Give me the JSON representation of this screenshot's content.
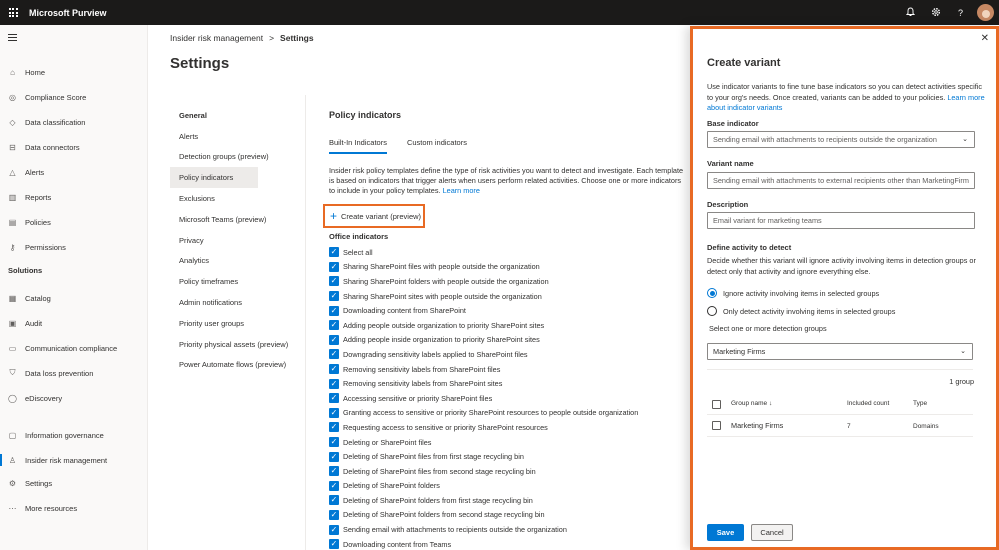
{
  "app": {
    "title": "Microsoft Purview"
  },
  "topbar": {
    "icons": [
      "bell-icon",
      "gear-icon",
      "help-icon"
    ]
  },
  "leftnav": {
    "items": [
      {
        "label": "Home",
        "icon": "home-icon"
      },
      {
        "label": "Compliance Score",
        "icon": "trophy-icon"
      },
      {
        "label": "Data classification",
        "icon": "tag-icon"
      },
      {
        "label": "Data connectors",
        "icon": "connector-icon"
      },
      {
        "label": "Alerts",
        "icon": "alert-icon"
      },
      {
        "label": "Reports",
        "icon": "chart-icon"
      },
      {
        "label": "Policies",
        "icon": "policy-icon"
      },
      {
        "label": "Permissions",
        "icon": "key-icon"
      }
    ],
    "section_label": "Solutions",
    "solution_items": [
      {
        "label": "Catalog",
        "icon": "catalog-icon"
      },
      {
        "label": "Audit",
        "icon": "audit-icon"
      },
      {
        "label": "Communication compliance",
        "icon": "chat-icon"
      },
      {
        "label": "Data loss prevention",
        "icon": "shield-icon"
      },
      {
        "label": "eDiscovery",
        "icon": "search-icon"
      },
      {
        "label": "Information governance",
        "icon": "governance-icon"
      },
      {
        "label": "Insider risk management",
        "icon": "person-icon"
      },
      {
        "label": "Settings",
        "icon": "gear-icon"
      },
      {
        "label": "More resources",
        "icon": "more-icon"
      }
    ]
  },
  "breadcrumb": {
    "parent": "Insider risk management",
    "separator": ">",
    "current": "Settings"
  },
  "page": {
    "title": "Settings"
  },
  "settings_nav": {
    "header": "General",
    "items": [
      "Alerts",
      "Detection groups (preview)",
      "Policy indicators",
      "Exclusions",
      "Microsoft Teams (preview)",
      "Privacy",
      "Analytics",
      "Policy timeframes",
      "Admin notifications",
      "Priority user groups",
      "Priority physical assets (preview)",
      "Power Automate flows (preview)"
    ]
  },
  "main": {
    "title": "Policy indicators",
    "tabs": [
      "Built-In Indicators",
      "Custom indicators"
    ],
    "intro": "Insider risk policy templates define the type of risk activities you want to detect and investigate. Each template is based on indicators that trigger alerts when users perform related activities. Choose one or more indicators to include in your policy templates.",
    "learn_more": "Learn more",
    "create_button": "Create variant (preview)",
    "office_indicators_title": "Office indicators",
    "indicators": [
      "Select all",
      "Sharing SharePoint files with people outside the organization",
      "Sharing SharePoint folders with people outside the organization",
      "Sharing SharePoint sites with people outside the organization",
      "Downloading content from SharePoint",
      "Adding people outside organization to priority SharePoint sites",
      "Adding people inside organization to priority SharePoint sites",
      "Downgrading sensitivity labels applied to SharePoint files",
      "Removing sensitivity labels from SharePoint files",
      "Removing sensitivity labels from SharePoint sites",
      "Accessing sensitive or priority SharePoint files",
      "Granting access to sensitive or priority SharePoint resources to people outside organization",
      "Requesting access to sensitive or priority SharePoint resources",
      "Deleting or SharePoint files",
      "Deleting of SharePoint files from first stage recycling bin",
      "Deleting of SharePoint files from second stage recycling bin",
      "Deleting of SharePoint folders",
      "Deleting of SharePoint folders from first stage recycling bin",
      "Deleting of SharePoint folders from second stage recycling bin",
      "Sending email with attachments to recipients outside the organization",
      "Downloading content from Teams"
    ]
  },
  "panel": {
    "title": "Create variant",
    "description": "Use indicator variants to fine tune base indicators so you can detect activities specific to your org's needs. Once created, variants can be added to your policies.",
    "description_link": "Learn more about indicator variants",
    "base_indicator_label": "Base indicator",
    "base_indicator_value": "Sending email with attachments to recipients outside the organization",
    "variant_name_label": "Variant name",
    "variant_name_value": "Sending email with attachments to external recipients other than MarketingFirm",
    "description_label": "Description",
    "description_value": "Email variant for marketing teams",
    "define_label": "Define activity to detect",
    "define_desc": "Decide whether this variant will ignore activity involving items in detection groups or detect only that activity and ignore everything else.",
    "radio_options": [
      "Ignore activity involving items in selected groups",
      "Only detect activity involving items in selected groups"
    ],
    "selected_radio": 0,
    "select_groups_label": "Select one or more detection groups",
    "groups_dropdown_value": "Marketing Firms",
    "group_count": "1 group",
    "table_headers": [
      "Group name",
      "Included count",
      "Type"
    ],
    "table_rows": [
      {
        "name": "Marketing Firms",
        "count": "7",
        "type": "Domains"
      }
    ],
    "save_label": "Save",
    "cancel_label": "Cancel"
  },
  "colors": {
    "accent": "#0078d4",
    "highlight": "#e86a24",
    "topbar": "#1b1a19"
  }
}
